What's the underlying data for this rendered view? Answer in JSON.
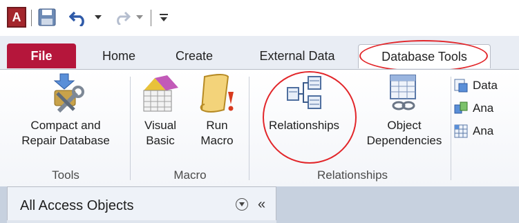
{
  "qat": {
    "app_letter": "A",
    "icons": [
      "access-app-icon",
      "save-icon",
      "undo-icon",
      "redo-icon",
      "customize-icon"
    ]
  },
  "tabs": [
    {
      "label": "File"
    },
    {
      "label": "Home"
    },
    {
      "label": "Create"
    },
    {
      "label": "External Data"
    },
    {
      "label": "Database Tools",
      "active": true
    }
  ],
  "ribbon": {
    "groups": [
      {
        "label": "Tools",
        "buttons": [
          {
            "label_line1": "Compact and",
            "label_line2": "Repair Database"
          }
        ]
      },
      {
        "label": "Macro",
        "buttons": [
          {
            "label_line1": "Visual",
            "label_line2": "Basic"
          },
          {
            "label_line1": "Run",
            "label_line2": "Macro"
          }
        ]
      },
      {
        "label": "Relationships",
        "buttons": [
          {
            "label_line1": "Relationships",
            "label_line2": ""
          },
          {
            "label_line1": "Object",
            "label_line2": "Dependencies"
          }
        ]
      }
    ],
    "small_buttons": [
      "Data",
      "Ana",
      "Ana"
    ]
  },
  "navpane": {
    "title": "All Access Objects",
    "collapse_glyph": "«"
  },
  "colors": {
    "file_tab": "#b5163b",
    "annotation": "#e2262a",
    "tab_bar": "#e9edf4"
  }
}
